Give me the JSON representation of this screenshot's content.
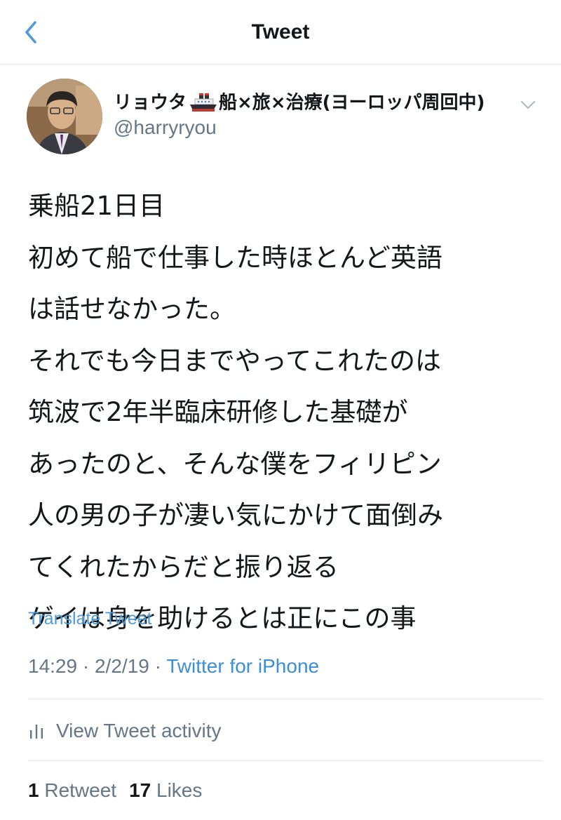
{
  "header": {
    "title": "Tweet",
    "back_icon": "chevron-left-icon",
    "accent_color": "#4f9bd9"
  },
  "author": {
    "name_prefix": "リョウタ",
    "name_emoji": "ship-emoji",
    "name_suffix": "船×旅×治療(ヨーロッパ周回中)",
    "handle": "@harryryou",
    "more_icon": "chevron-down-icon"
  },
  "tweet": {
    "lines": [
      "乗船21日目",
      "初めて船で仕事した時ほとんど英語",
      "は話せなかった。",
      "それでも今日までやってこれたのは",
      "筑波で2年半臨床研修した基礎が",
      "あったのと、そんな僕をフィリピン",
      "人の男の子が凄い気にかけて面倒み",
      "てくれたからだと振り返る",
      "ゲイは身を助けるとは正にこの事"
    ],
    "translate_label": "Translate Tweet",
    "time": "14:29",
    "date": "2/2/19",
    "separator": "·",
    "source": "Twitter for iPhone"
  },
  "activity": {
    "icon": "bar-chart-icon",
    "label": "View Tweet activity"
  },
  "stats": {
    "retweets_count": "1",
    "retweets_label": "Retweet",
    "likes_count": "17",
    "likes_label": "Likes"
  }
}
